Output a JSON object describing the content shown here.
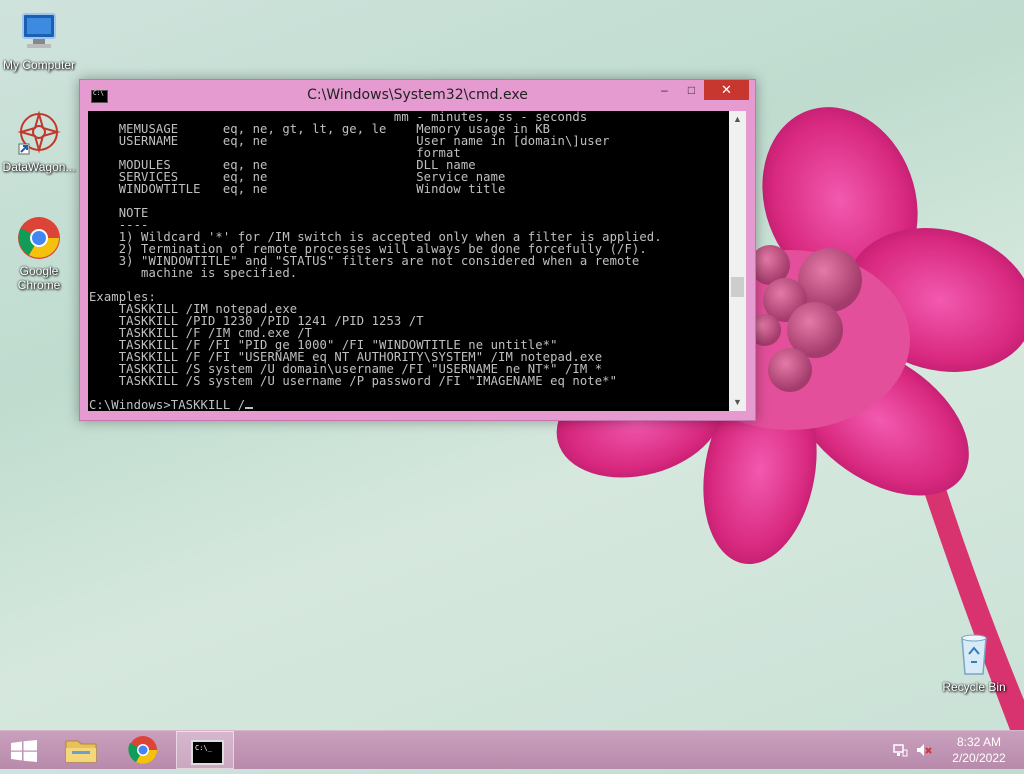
{
  "desktop": {
    "icons": [
      {
        "label": "My Computer",
        "icon": "computer-icon"
      },
      {
        "label": "DataWagon...",
        "icon": "datawagon-icon"
      },
      {
        "label": "Google Chrome",
        "icon": "chrome-icon"
      },
      {
        "label": "Recycle Bin",
        "icon": "recycle-bin-icon"
      }
    ]
  },
  "window": {
    "title": "C:\\Windows\\System32\\cmd.exe",
    "minimize": "–",
    "maximize": "□",
    "close": "✕"
  },
  "console": {
    "lines": [
      "                                         mm - minutes, ss - seconds",
      "    MEMUSAGE      eq, ne, gt, lt, ge, le    Memory usage in KB",
      "    USERNAME      eq, ne                    User name in [domain\\]user",
      "                                            format",
      "    MODULES       eq, ne                    DLL name",
      "    SERVICES      eq, ne                    Service name",
      "    WINDOWTITLE   eq, ne                    Window title",
      "",
      "    NOTE",
      "    ----",
      "    1) Wildcard '*' for /IM switch is accepted only when a filter is applied.",
      "    2) Termination of remote processes will always be done forcefully (/F).",
      "    3) \"WINDOWTITLE\" and \"STATUS\" filters are not considered when a remote",
      "       machine is specified.",
      "",
      "Examples:",
      "    TASKKILL /IM notepad.exe",
      "    TASKKILL /PID 1230 /PID 1241 /PID 1253 /T",
      "    TASKKILL /F /IM cmd.exe /T",
      "    TASKKILL /F /FI \"PID ge 1000\" /FI \"WINDOWTITLE ne untitle*\"",
      "    TASKKILL /F /FI \"USERNAME eq NT AUTHORITY\\SYSTEM\" /IM notepad.exe",
      "    TASKKILL /S system /U domain\\username /FI \"USERNAME ne NT*\" /IM *",
      "    TASKKILL /S system /U username /P password /FI \"IMAGENAME eq note*\"",
      ""
    ],
    "prompt": "C:\\Windows>TASKKILL /"
  },
  "taskbar": {
    "time": "8:32 AM",
    "date": "2/20/2022"
  },
  "colors": {
    "window_frame": "#e59ad0",
    "close_button": "#c7372f",
    "taskbar": "#c19ab5",
    "console_bg": "#000000",
    "console_fg": "#c0c0c0"
  }
}
